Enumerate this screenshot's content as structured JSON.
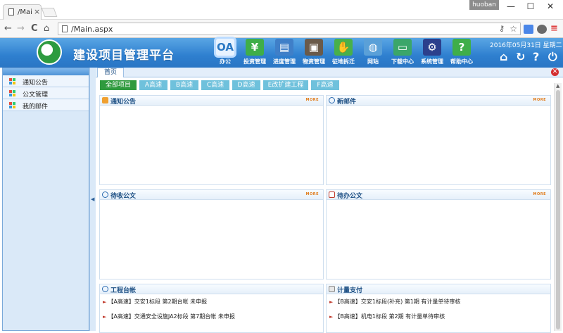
{
  "browser": {
    "tab_title": "/Mai",
    "tab_close": "×",
    "user": "huoban",
    "win_minimize": "—",
    "win_maximize": "☐",
    "win_close": "✕",
    "back": "←",
    "forward": "→",
    "reload": "C",
    "home": "⌂",
    "url": "/Main.aspx",
    "star": "☆",
    "key": "⚷",
    "menu": "≡"
  },
  "header": {
    "title": "建设项目管理平台",
    "datetime": "2016年05月31日 星期二",
    "nav": [
      {
        "label": "办公",
        "icon": "OA",
        "icon_name": "oa-icon",
        "color": "#ffffff"
      },
      {
        "label": "投资管理",
        "icon": "¥",
        "icon_name": "yen-icon",
        "color": "#3fae49"
      },
      {
        "label": "进度管理",
        "icon": "▤",
        "icon_name": "schedule-icon",
        "color": "#3f7fc8"
      },
      {
        "label": "物资管理",
        "icon": "▣",
        "icon_name": "materials-icon",
        "color": "#6a5a4a"
      },
      {
        "label": "征地拆迁",
        "icon": "✋",
        "icon_name": "handshake-icon",
        "color": "#48b04a"
      },
      {
        "label": "网站",
        "icon": "◍",
        "icon_name": "globe-icon",
        "color": "#5aa0d8"
      },
      {
        "label": "下载中心",
        "icon": "▭",
        "icon_name": "folder-icon",
        "color": "#3ba66a"
      },
      {
        "label": "系统管理",
        "icon": "⚙",
        "icon_name": "gear-icon",
        "color": "#2b3f8c"
      },
      {
        "label": "帮助中心",
        "icon": "?",
        "icon_name": "help-icon",
        "color": "#3fae49"
      }
    ],
    "home_btn": "⌂",
    "refresh_btn": "↻",
    "help_btn": "?",
    "power_btn": "⏻"
  },
  "sidebar": {
    "items": [
      {
        "label": "通知公告"
      },
      {
        "label": "公文管理"
      },
      {
        "label": "我的邮件"
      }
    ],
    "collapse": "◀"
  },
  "main": {
    "home_tab": "首页",
    "close": "✕",
    "filters": [
      {
        "label": "全部项目"
      },
      {
        "label": "A高速"
      },
      {
        "label": "B高速"
      },
      {
        "label": "C高速"
      },
      {
        "label": "D高速"
      },
      {
        "label": "E改扩建工程"
      },
      {
        "label": "F高速"
      }
    ],
    "more_label": "MORE",
    "panels": {
      "notice": {
        "title": "通知公告"
      },
      "mail": {
        "title": "新邮件"
      },
      "inbox_doc": {
        "title": "待收公文"
      },
      "todo_doc": {
        "title": "待办公文"
      },
      "ledger": {
        "title": "工程台帐",
        "rows": [
          "【A高速】交安1标段 第2期台帐 未申报",
          "【A高速】交通安全设施JA2标段 第7期台帐 未申报"
        ]
      },
      "payment": {
        "title": "计量支付",
        "rows": [
          "【B高速】交安1标段(补充) 第1期 有计量单待审核",
          "【B高速】机电1标段 第2期 有计量单待审核"
        ]
      }
    }
  },
  "colors": {
    "header_blue": "#2e7fcf",
    "active_filter": "#2f9a3e",
    "filter": "#6fc1dc",
    "more_orange": "#e07a18"
  }
}
